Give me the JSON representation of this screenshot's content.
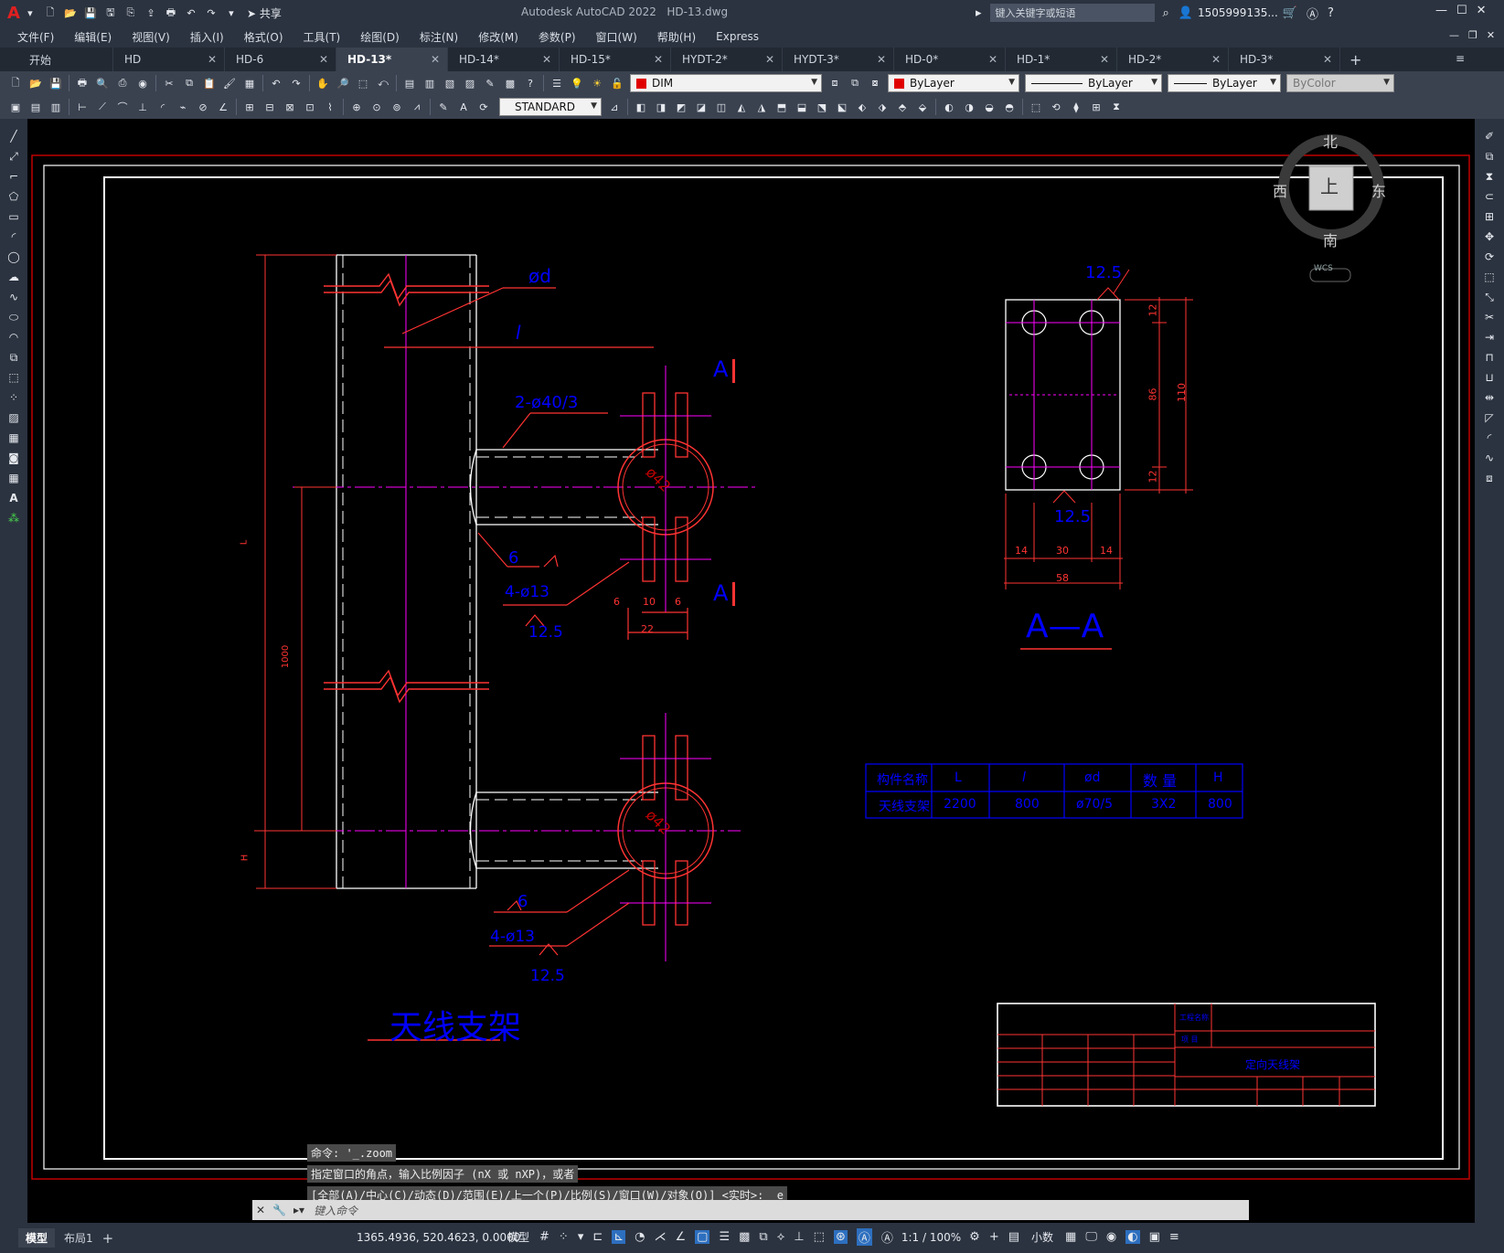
{
  "app": {
    "title": "Autodesk AutoCAD 2022",
    "file": "HD-13.dwg",
    "share_label": "共享",
    "search_placeholder": "键入关键字或短语",
    "user": "1505999135..."
  },
  "menu": [
    "文件(F)",
    "编辑(E)",
    "视图(V)",
    "插入(I)",
    "格式(O)",
    "工具(T)",
    "绘图(D)",
    "标注(N)",
    "修改(M)",
    "参数(P)",
    "窗口(W)",
    "帮助(H)",
    "Express"
  ],
  "tabs": [
    "开始",
    "HD",
    "HD-6",
    "HD-13*",
    "HD-14*",
    "HD-15*",
    "HYDT-2*",
    "HYDT-3*",
    "HD-0*",
    "HD-1*",
    "HD-2*",
    "HD-3*"
  ],
  "toolbar": {
    "layer": "DIM",
    "color": "ByLayer",
    "linetype": "ByLayer",
    "lineweight": "ByLayer",
    "plotstyle": "ByColor",
    "textstyle": "STANDARD"
  },
  "viewcube": {
    "north": "北",
    "south": "南",
    "east": "东",
    "west": "西",
    "top": "上",
    "wcs": "WCS"
  },
  "drawing": {
    "dim_od": "ød",
    "dim_l": "l",
    "section_mark": "A",
    "dim_holes_large": "2-ø40/3",
    "dim_dia": "ø42",
    "weld": "6",
    "dim_bolts": "4-ø13",
    "rough": "12.5",
    "bot_dims": [
      "6",
      "10",
      "6",
      "22"
    ],
    "dim_L": "L",
    "dim_1000": "1000",
    "dim_H": "H",
    "section_title": "A—A",
    "aa_dims_right": [
      "12",
      "86",
      "12",
      "110"
    ],
    "aa_dims_bottom": [
      "14",
      "30",
      "14",
      "58"
    ],
    "title": "天线支架",
    "table": {
      "headers": [
        "构件名称",
        "L",
        "l",
        "ød",
        "数 量",
        "H"
      ],
      "row": [
        "天线支架",
        "2200",
        "800",
        "ø70/5",
        "3X2",
        "800"
      ]
    },
    "titleblock": {
      "project": "工程名称",
      "item": "项 目",
      "drawing_name": "定向天线架"
    }
  },
  "command": {
    "history": [
      "命令: '_.zoom",
      "指定窗口的角点，输入比例因子 (nX 或 nXP)，或者",
      "[全部(A)/中心(C)/动态(D)/范围(E)/上一个(P)/比例(S)/窗口(W)/对象(O)] <实时>: _e"
    ],
    "placeholder": "键入命令"
  },
  "status": {
    "tabs": [
      "模型",
      "布局1"
    ],
    "coords": "1365.4936, 520.4623, 0.0000",
    "space": "模型",
    "scale": "1:1 / 100%",
    "units": "小数"
  }
}
